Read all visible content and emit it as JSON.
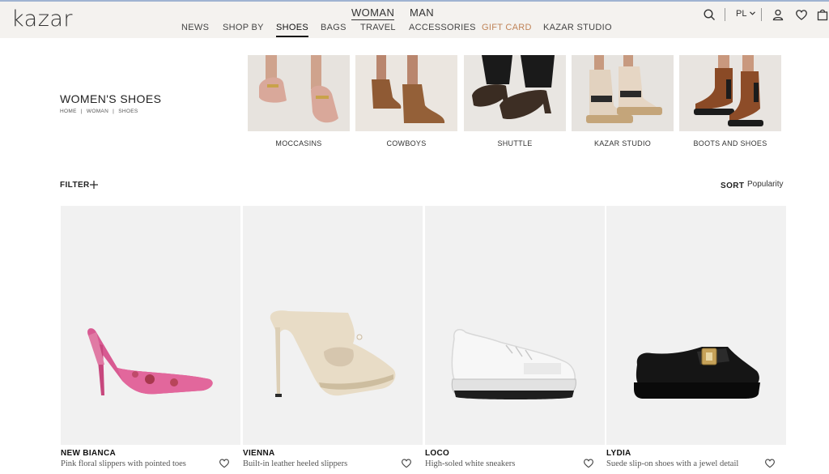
{
  "header": {
    "logo": "kazar",
    "genders": [
      {
        "label": "WOMAN",
        "active": true
      },
      {
        "label": "MAN",
        "active": false
      }
    ],
    "nav": [
      "NEWS",
      "SHOP BY",
      "SHOES",
      "BAGS",
      "TRAVEL",
      "ACCESSORIES",
      "GIFT CARD",
      "KAZAR STUDIO"
    ],
    "language": "PL",
    "icons": [
      "search-icon",
      "chevron-down-icon",
      "user-icon",
      "heart-icon",
      "bag-icon"
    ]
  },
  "page": {
    "title": "WOMEN'S SHOES",
    "breadcrumb": [
      "HOME",
      "|",
      "WOMAN",
      "|",
      "SHOES"
    ]
  },
  "categories": [
    {
      "label": "MOCCASINS"
    },
    {
      "label": "COWBOYS"
    },
    {
      "label": "SHUTTLE"
    },
    {
      "label": "KAZAR STUDIO"
    },
    {
      "label": "BOOTS AND SHOES"
    }
  ],
  "toolbar": {
    "filter_label": "FILTER",
    "sort_label": "SORT",
    "sort_value": "Popularity"
  },
  "products": [
    {
      "name": "NEW BIANCA",
      "desc": "Pink floral slippers with pointed toes"
    },
    {
      "name": "VIENNA",
      "desc": "Built-in leather heeled slippers"
    },
    {
      "name": "LOCO",
      "desc": "High-soled white sneakers"
    },
    {
      "name": "LYDIA",
      "desc": "Suede slip-on shoes with a jewel detail"
    }
  ],
  "colors": {
    "header_bg": "#f4f2ef",
    "gift_card": "#c08458",
    "product_bg": "#f1f1f1"
  }
}
